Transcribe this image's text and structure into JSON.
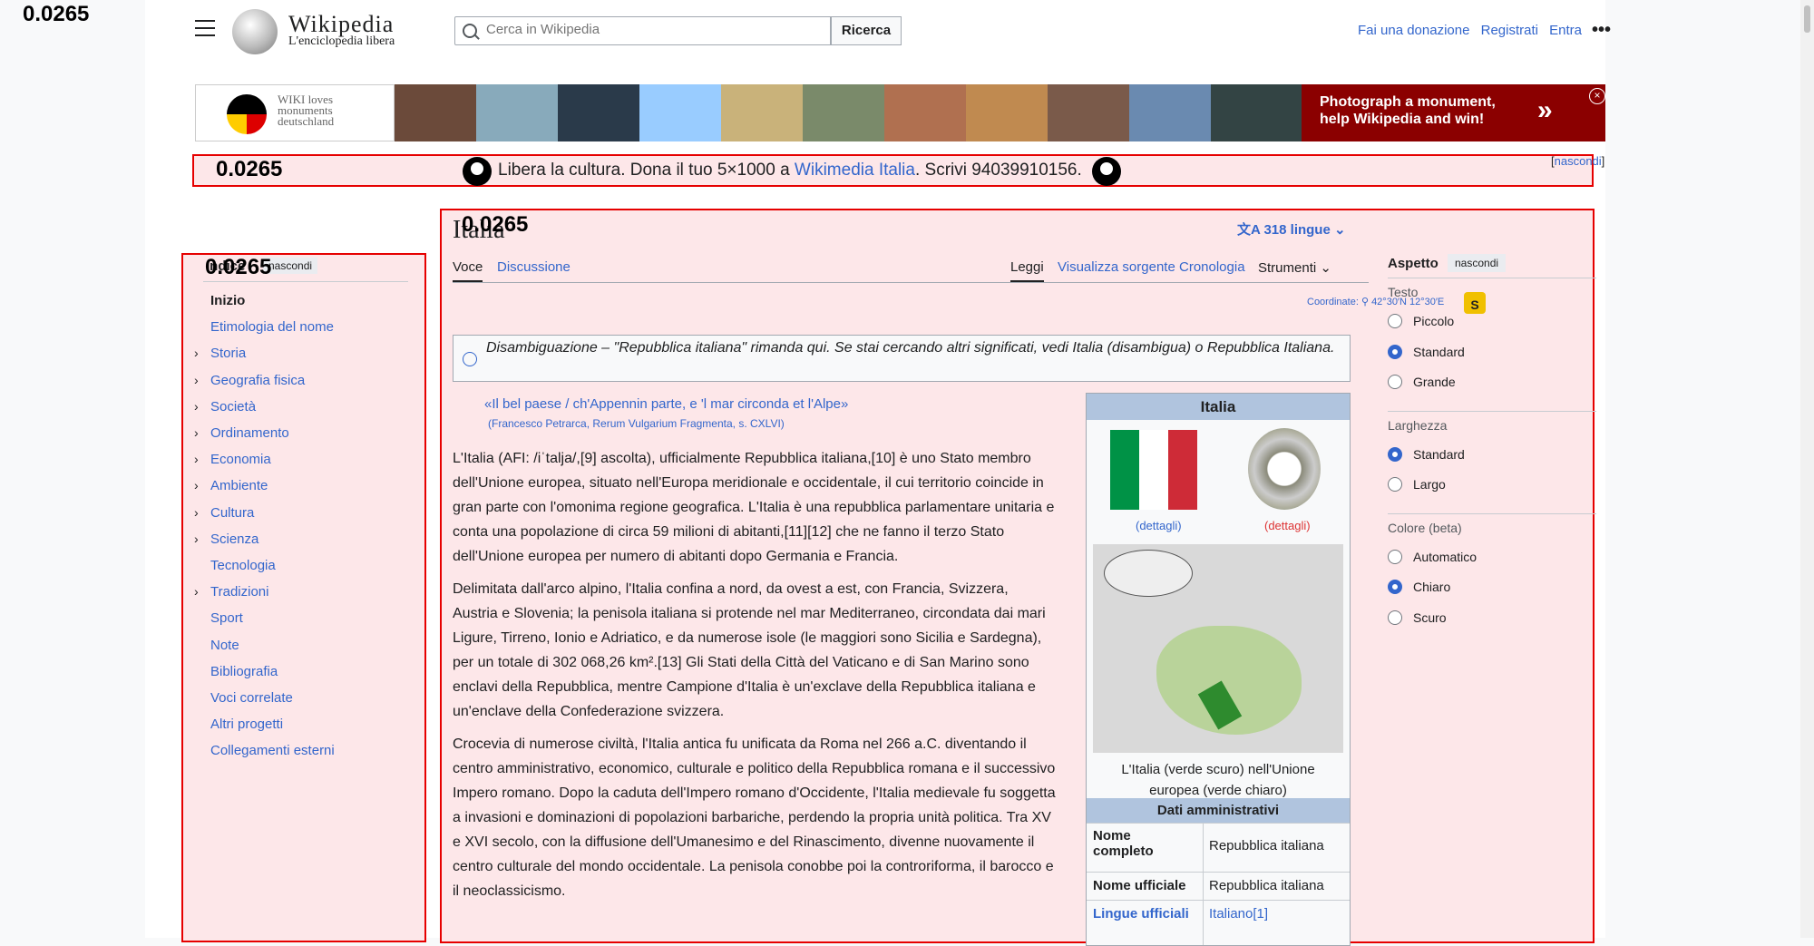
{
  "overlay_value": "0.0265",
  "header": {
    "logo_word": "Wikipedia",
    "logo_tagline": "L'enciclopedia libera",
    "search_placeholder": "Cerca in Wikipedia",
    "search_button": "Ricerca",
    "links": [
      "Fai una donazione",
      "Registrati",
      "Entra"
    ],
    "more": "•••"
  },
  "banner": {
    "logo_text": [
      "WIKI loves",
      "monuments",
      "deutschland"
    ],
    "text": "Photograph a monument, help Wikipedia and win!",
    "arrow": "»",
    "close": "×"
  },
  "cultura": {
    "pre": "Libera la cultura. Dona il tuo 5×1000 a ",
    "link": "Wikimedia Italia",
    "post": ". Scrivi 94039910156.",
    "hide": "nascondi"
  },
  "toc": {
    "title": "Indice",
    "hide": "nascondi",
    "items": [
      {
        "label": "Inizio",
        "current": true,
        "expandable": false
      },
      {
        "label": "Etimologia del nome",
        "expandable": false
      },
      {
        "label": "Storia",
        "expandable": true
      },
      {
        "label": "Geografia fisica",
        "expandable": true
      },
      {
        "label": "Società",
        "expandable": true
      },
      {
        "label": "Ordinamento",
        "expandable": true
      },
      {
        "label": "Economia",
        "expandable": true
      },
      {
        "label": "Ambiente",
        "expandable": true
      },
      {
        "label": "Cultura",
        "expandable": true
      },
      {
        "label": "Scienza",
        "expandable": true
      },
      {
        "label": "Tecnologia",
        "expandable": false
      },
      {
        "label": "Tradizioni",
        "expandable": true
      },
      {
        "label": "Sport",
        "expandable": false
      },
      {
        "label": "Note",
        "expandable": false
      },
      {
        "label": "Bibliografia",
        "expandable": false
      },
      {
        "label": "Voci correlate",
        "expandable": false
      },
      {
        "label": "Altri progetti",
        "expandable": false
      },
      {
        "label": "Collegamenti esterni",
        "expandable": false
      }
    ]
  },
  "article": {
    "title": "Italia",
    "languages": "318 lingue",
    "tabs_left": [
      "Voce",
      "Discussione"
    ],
    "tabs_right": [
      "Leggi",
      "Visualizza sorgente",
      "Cronologia",
      "Strumenti"
    ],
    "coords_label": "Coordinate:",
    "coords_value": "42°30′N 12°30′E",
    "lock": "S",
    "disambig": "Disambiguazione – \"Repubblica italiana\" rimanda qui. Se stai cercando altri significati, vedi Italia (disambigua) o Repubblica Italiana.",
    "quote": "«Il bel paese / ch'Appennin parte, e 'l mar circonda et l'Alpe»",
    "quote_source": "(Francesco Petrarca, Rerum Vulgarium Fragmenta, s. CXLVI)",
    "paragraphs": [
      "L'Italia (AFI: /iˈtalja/,[9] ascolta), ufficialmente Repubblica italiana,[10] è uno Stato membro dell'Unione europea, situato nell'Europa meridionale e occidentale, il cui territorio coincide in gran parte con l'omonima regione geografica. L'Italia è una repubblica parlamentare unitaria e conta una popolazione di circa 59 milioni di abitanti,[11][12] che ne fanno il terzo Stato dell'Unione europea per numero di abitanti dopo Germania e Francia.",
      "Delimitata dall'arco alpino, l'Italia confina a nord, da ovest a est, con Francia, Svizzera, Austria e Slovenia; la penisola italiana si protende nel mar Mediterraneo, circondata dai mari Ligure, Tirreno, Ionio e Adriatico, e da numerose isole (le maggiori sono Sicilia e Sardegna), per un totale di 302 068,26 km².[13] Gli Stati della Città del Vaticano e di San Marino sono enclavi della Repubblica, mentre Campione d'Italia è un'exclave della Repubblica italiana e un'enclave della Confederazione svizzera.",
      "Crocevia di numerose civiltà, l'Italia antica fu unificata da Roma nel 266 a.C. diventando il centro amministrativo, economico, culturale e politico della Repubblica romana e il successivo Impero romano. Dopo la caduta dell'Impero romano d'Occidente, l'Italia medievale fu soggetta a invasioni e dominazioni di popolazioni barbariche, perdendo la propria unità politica. Tra XV e XVI secolo, con la diffusione dell'Umanesimo e del Rinascimento, divenne nuovamente il centro culturale del mondo occidentale. La penisola conobbe poi la controriforma, il barocco e il neoclassicismo."
    ]
  },
  "infobox": {
    "title": "Italia",
    "details": [
      "(dettagli)",
      "(dettagli)"
    ],
    "caption": "L'Italia (verde scuro) nell'Unione europea (verde chiaro)",
    "section": "Dati amministrativi",
    "rows": [
      {
        "k": "Nome completo",
        "v": "Repubblica italiana"
      },
      {
        "k": "Nome ufficiale",
        "v": "Repubblica italiana"
      },
      {
        "k": "Lingue ufficiali",
        "v": "Italiano[1]"
      }
    ]
  },
  "appearance": {
    "title": "Aspetto",
    "hide": "nascondi",
    "groups": [
      {
        "label": "Testo",
        "options": [
          "Piccolo",
          "Standard",
          "Grande"
        ],
        "selected": "Standard"
      },
      {
        "label": "Larghezza",
        "options": [
          "Standard",
          "Largo"
        ],
        "selected": "Standard"
      },
      {
        "label": "Colore (beta)",
        "options": [
          "Automatico",
          "Chiaro",
          "Scuro"
        ],
        "selected": "Chiaro"
      }
    ]
  }
}
